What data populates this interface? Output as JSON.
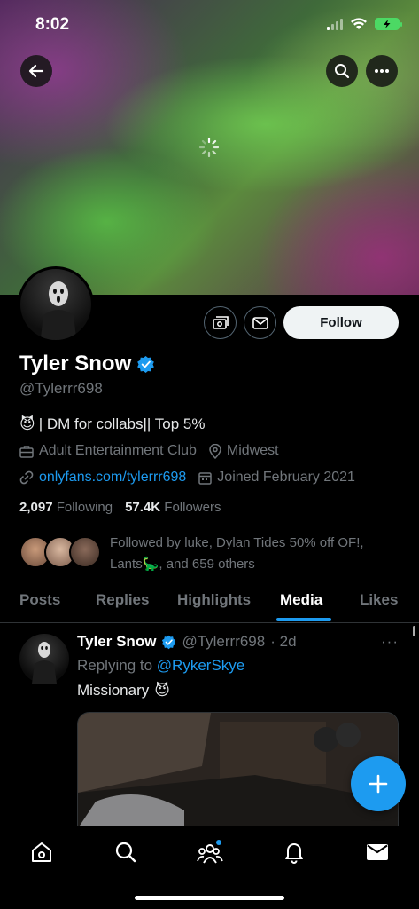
{
  "status": {
    "time": "8:02"
  },
  "colors": {
    "accent": "#1d9bf0",
    "background": "#000000",
    "muted": "#71767b"
  },
  "header": {
    "back_icon": "arrow-left-icon",
    "search_icon": "search-icon",
    "more_icon": "more-horizontal-icon",
    "loading_icon": "spinner-icon"
  },
  "profile": {
    "name": "Tyler Snow",
    "verified_icon": "verified-badge-icon",
    "handle": "@Tylerrr698",
    "bio_emoji": "😈",
    "bio": "| DM for collabs|| Top 5%",
    "category": "Adult Entertainment Club",
    "location": "Midwest",
    "link": "onlyfans.com/tylerrr698",
    "joined": "Joined February 2021",
    "following_count": "2,097",
    "following_label": "Following",
    "followers_count": "57.4K",
    "followers_label": "Followers",
    "followed_by": "Followed by luke, Dylan Tides 50% off OF!, Lants🦕, and 659 others",
    "follow_label": "Follow"
  },
  "tabs": [
    {
      "label": "Posts"
    },
    {
      "label": "Replies"
    },
    {
      "label": "Highlights"
    },
    {
      "label": "Media"
    },
    {
      "label": "Likes"
    }
  ],
  "active_tab": "Media",
  "post": {
    "author": "Tyler Snow",
    "handle": "@Tylerrr698",
    "time": "· 2d",
    "more": "···",
    "replying_prefix": "Replying to",
    "replying_to": "@RykerSkye",
    "text": "Missionary",
    "emoji": "😈"
  },
  "bottom_nav": [
    {
      "name": "home"
    },
    {
      "name": "search"
    },
    {
      "name": "communities"
    },
    {
      "name": "notifications"
    },
    {
      "name": "messages"
    }
  ]
}
